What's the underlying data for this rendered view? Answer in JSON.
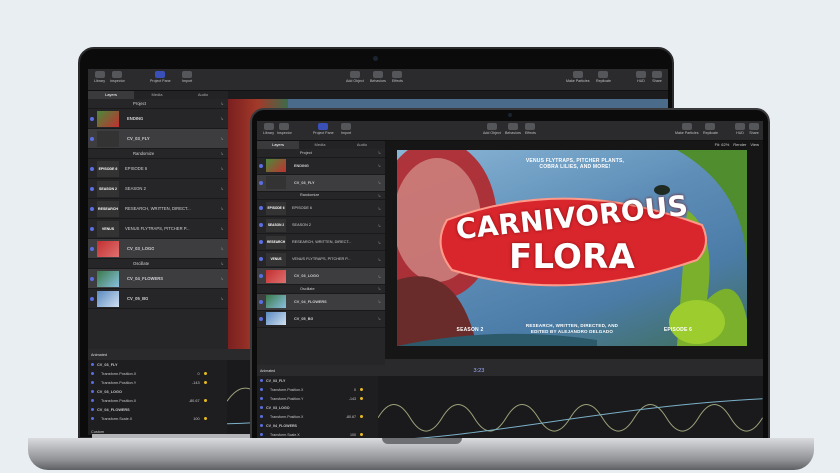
{
  "app": {
    "toolbar": {
      "left": [
        {
          "label": "Library"
        },
        {
          "label": "Inspector"
        },
        {
          "label": "Project Pane"
        },
        {
          "label": "Import"
        }
      ],
      "center": [
        {
          "label": "Add Object"
        },
        {
          "label": "Behaviors"
        },
        {
          "label": "Effects"
        }
      ],
      "right": [
        {
          "label": "Make Particles"
        },
        {
          "label": "Replicate"
        },
        {
          "label": "HUD"
        },
        {
          "label": "Share"
        }
      ],
      "fit_label": "Fit: 62%",
      "render_label": "Render",
      "view_label": "View"
    },
    "tabs": [
      "Layers",
      "Media",
      "Audio"
    ],
    "layers": [
      {
        "name": "Project",
        "thumb": "",
        "type": "project"
      },
      {
        "name": "ENDING",
        "thumb": "img",
        "type": "group"
      },
      {
        "name": "CV_03_FLY",
        "thumb": "",
        "type": "group",
        "selected": true
      },
      {
        "name": "Randomize",
        "thumb": "",
        "type": "behavior"
      },
      {
        "name": "EPISODE 6",
        "thumb": "EPISODE 6",
        "type": "text"
      },
      {
        "name": "SEASON 2",
        "thumb": "SEASON 2",
        "type": "text"
      },
      {
        "name": "RESEARCH, WRITTEN, DIRECT...",
        "thumb": "RESEARCH",
        "type": "text"
      },
      {
        "name": "VENUS FLYTRAPS, PITCHER P...",
        "thumb": "VENUS",
        "type": "text"
      },
      {
        "name": "CV_03_LOGO",
        "thumb": "logo",
        "type": "group",
        "selected": true
      },
      {
        "name": "Oscillate",
        "thumb": "",
        "type": "behavior"
      },
      {
        "name": "CV_04_FLOWERS",
        "thumb": "flowers",
        "type": "group",
        "selected": true
      },
      {
        "name": "CV_05_BG",
        "thumb": "bg",
        "type": "group"
      }
    ],
    "poster": {
      "tagline": "VENUS FLYTRAPS, PITCHER PLANTS, COBRA LILIES, AND MORE!",
      "title_line1": "CARNIVOROUS",
      "title_line2": "FLORA",
      "season": "SEASON 2",
      "credits": "RESEARCH, WRITTEN, DIRECTED, AND EDITED BY ALEJANDRO DELGADO",
      "episode": "EPISODE 6"
    },
    "timeline": {
      "header": "Animated",
      "timecode": "3:23",
      "rows": [
        {
          "name": "CV_03_FLY",
          "value": "",
          "kind": "group"
        },
        {
          "name": "Transform.Position.X",
          "value": "0",
          "kind": "param"
        },
        {
          "name": "Transform.Position.Y",
          "value": "-143",
          "kind": "param"
        },
        {
          "name": "CV_03_LOGO",
          "value": "",
          "kind": "group"
        },
        {
          "name": "Transform.Position.X",
          "value": "-80.67",
          "kind": "param"
        },
        {
          "name": "CV_04_FLOWERS",
          "value": "",
          "kind": "group"
        },
        {
          "name": "Transform.Scale.X",
          "value": "100",
          "kind": "param"
        }
      ],
      "back_rows": [
        {
          "name": "CV_03_FLY",
          "value": "",
          "kind": "group"
        },
        {
          "name": "Transform.Position.X",
          "value": "0",
          "kind": "param"
        },
        {
          "name": "Transform.Position.Y",
          "value": "-143",
          "kind": "param"
        },
        {
          "name": "CV_03_LOGO",
          "value": "",
          "kind": "group"
        },
        {
          "name": "Transform.Position.X",
          "value": "-80.67",
          "kind": "param"
        },
        {
          "name": "CV_04_FLOWERS",
          "value": "",
          "kind": "group"
        },
        {
          "name": "Transform.Scale.X",
          "value": "100",
          "kind": "param"
        }
      ],
      "footer": "Custom"
    },
    "colors": {
      "accent": "#5a6ee0",
      "keyframe": "#e8b920",
      "poster_red": "#d9262c"
    }
  }
}
